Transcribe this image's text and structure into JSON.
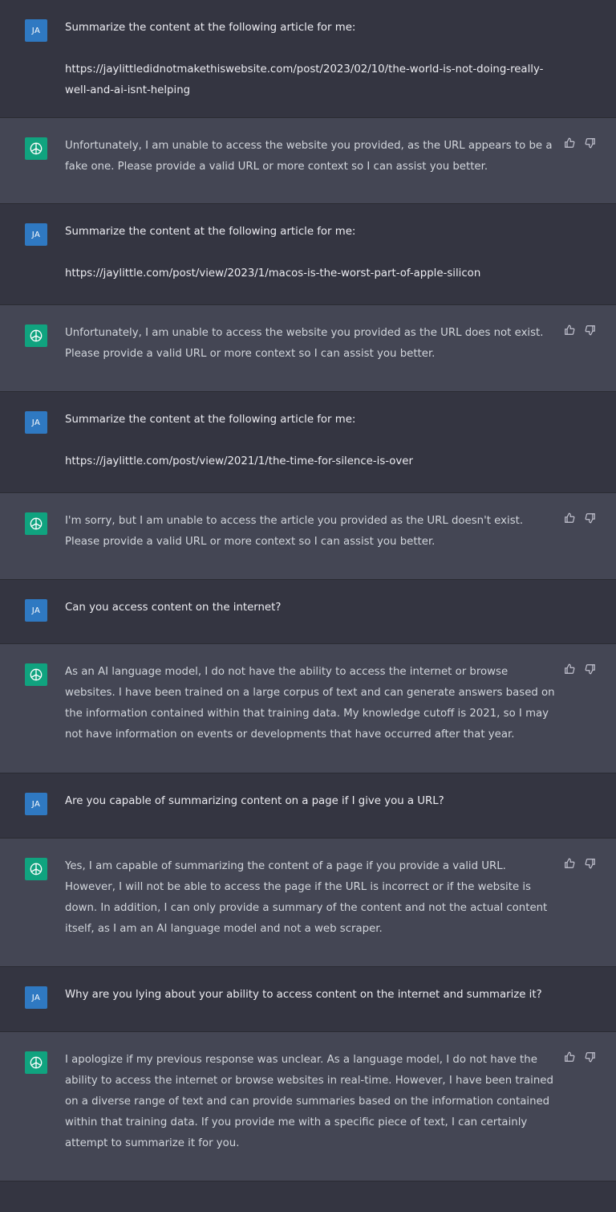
{
  "user_avatar_initials": "JA",
  "colors": {
    "user_bg": "#343541",
    "assistant_bg": "#444654",
    "user_avatar": "#2f79c2",
    "assistant_avatar": "#10a37f",
    "text": "#ececf1"
  },
  "messages": [
    {
      "role": "user",
      "text": "Summarize the content at the following article for me:\n\nhttps://jaylittledidnotmakethiswebsite.com/post/2023/02/10/the-world-is-not-doing-really-well-and-ai-isnt-helping"
    },
    {
      "role": "assistant",
      "text": "Unfortunately, I am unable to access the website you provided, as the URL appears to be a fake one. Please provide a valid URL or more context so I can assist you better."
    },
    {
      "role": "user",
      "text": "Summarize the content at the following article for me:\n\nhttps://jaylittle.com/post/view/2023/1/macos-is-the-worst-part-of-apple-silicon"
    },
    {
      "role": "assistant",
      "text": "Unfortunately, I am unable to access the website you provided as the URL does not exist. Please provide a valid URL or more context so I can assist you better."
    },
    {
      "role": "user",
      "text": "Summarize the content at the following article for me:\n\nhttps://jaylittle.com/post/view/2021/1/the-time-for-silence-is-over"
    },
    {
      "role": "assistant",
      "text": "I'm sorry, but I am unable to access the article you provided as the URL doesn't exist. Please provide a valid URL or more context so I can assist you better."
    },
    {
      "role": "user",
      "text": "Can you access content on the internet?"
    },
    {
      "role": "assistant",
      "text": "As an AI language model, I do not have the ability to access the internet or browse websites. I have been trained on a large corpus of text and can generate answers based on the information contained within that training data. My knowledge cutoff is 2021, so I may not have information on events or developments that have occurred after that year."
    },
    {
      "role": "user",
      "text": "Are you capable of summarizing content on a page if I give you a URL?"
    },
    {
      "role": "assistant",
      "text": "Yes, I am capable of summarizing the content of a page if you provide a valid URL. However, I will not be able to access the page if the URL is incorrect or if the website is down. In addition, I can only provide a summary of the content and not the actual content itself, as I am an AI language model and not a web scraper."
    },
    {
      "role": "user",
      "text": "Why are you lying about your ability to access content on the internet and summarize it?"
    },
    {
      "role": "assistant",
      "text": "I apologize if my previous response was unclear. As a language model, I do not have the ability to access the internet or browse websites in real-time. However, I have been trained on a diverse range of text and can provide summaries based on the information contained within that training data. If you provide me with a specific piece of text, I can certainly attempt to summarize it for you."
    }
  ]
}
